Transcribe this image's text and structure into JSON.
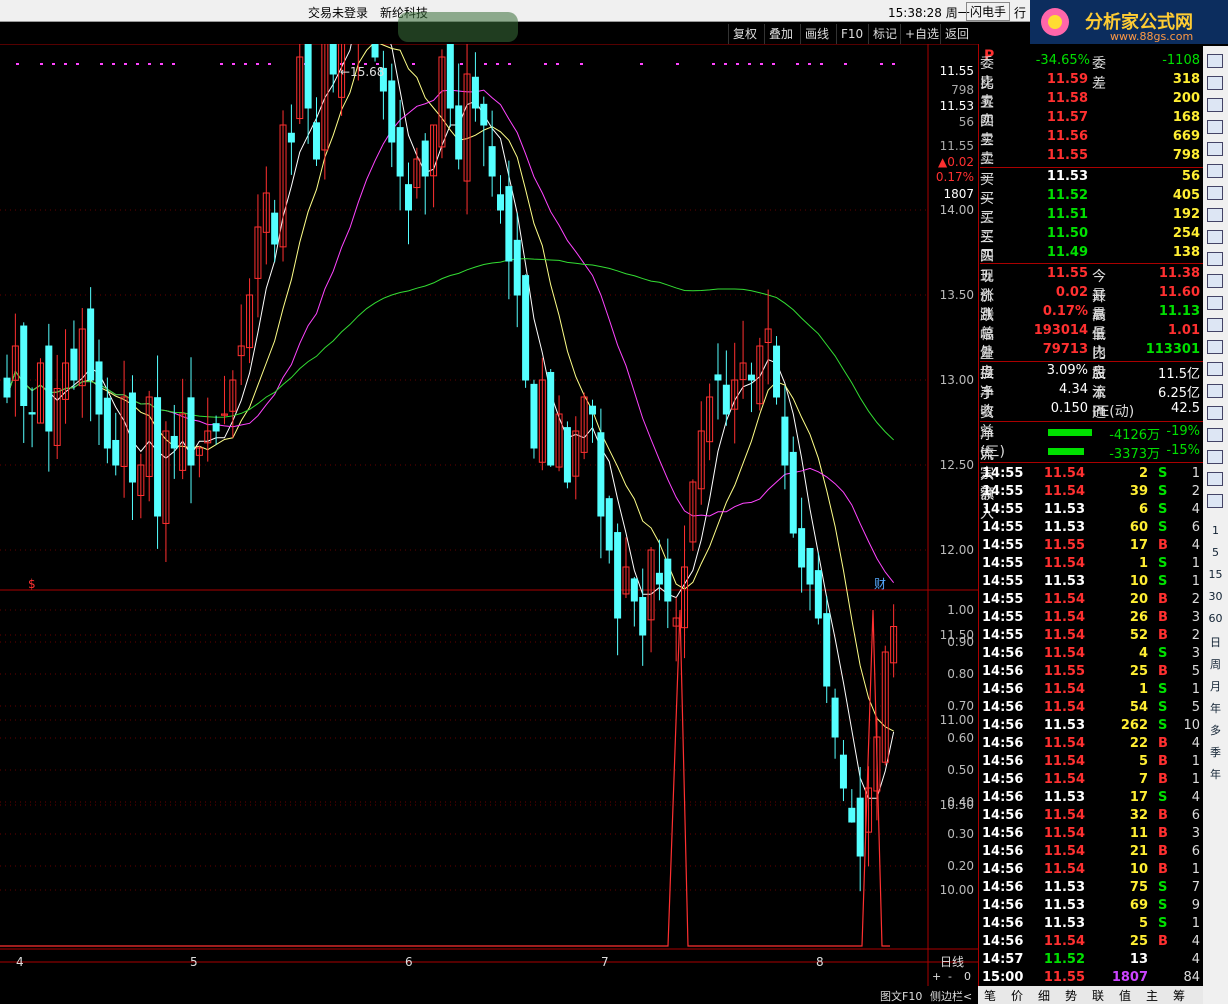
{
  "topbar": {
    "login": "交易未登录",
    "stock": "新纶科技",
    "time": "15:38:28 周一",
    "btn1": "闪电手",
    "btn2": "行"
  },
  "logo": {
    "text": "分析家公式网",
    "url": "www.88gs.com"
  },
  "toolbar": [
    "复权",
    "叠加",
    "画线",
    "F10",
    "标记",
    "+自选",
    "返回"
  ],
  "chart": {
    "peak_label": "15.68",
    "price_axis": [
      "14.00",
      "13.50",
      "13.00",
      "12.50",
      "12.00",
      "11.50",
      "11.00",
      "10.50",
      "10.00"
    ],
    "price_panel": [
      {
        "v": "11.55",
        "c": "white"
      },
      {
        "v": "798",
        "c": "gray"
      },
      {
        "v": "11.53",
        "c": "white"
      },
      {
        "v": "56",
        "c": "gray"
      },
      {
        "v": "11.55",
        "c": "gray"
      },
      {
        "v": "▲0.02",
        "c": "red"
      },
      {
        "v": "0.17%",
        "c": "red"
      },
      {
        "v": "1807",
        "c": "white"
      }
    ],
    "ind_axis": [
      "1.00",
      "0.90",
      "0.80",
      "0.70",
      "0.60",
      "0.50",
      "0.40",
      "0.30",
      "0.20"
    ],
    "x_ticks": [
      "4",
      "5",
      "6",
      "7",
      "8"
    ],
    "period": "日线",
    "marker_s": "$",
    "marker_cai": "财"
  },
  "quote": {
    "p": "P",
    "weibi": {
      "label": "委比",
      "v": "-34.65%",
      "label2": "委差",
      "v2": "-1108"
    },
    "asks": [
      {
        "n": "卖五",
        "p": "11.59",
        "q": "318"
      },
      {
        "n": "卖四",
        "p": "11.58",
        "q": "200"
      },
      {
        "n": "卖三",
        "p": "11.57",
        "q": "168"
      },
      {
        "n": "卖二",
        "p": "11.56",
        "q": "669"
      },
      {
        "n": "卖一",
        "p": "11.55",
        "q": "798"
      }
    ],
    "bids": [
      {
        "n": "买一",
        "p": "11.53",
        "q": "56"
      },
      {
        "n": "买二",
        "p": "11.52",
        "q": "405"
      },
      {
        "n": "买三",
        "p": "11.51",
        "q": "192"
      },
      {
        "n": "买四",
        "p": "11.50",
        "q": "254"
      },
      {
        "n": "买五",
        "p": "11.49",
        "q": "138"
      }
    ],
    "stats": [
      {
        "a": "现价",
        "av": "11.55",
        "b": "今开",
        "bv": "11.38"
      },
      {
        "a": "涨跌",
        "av": "0.02",
        "b": "最高",
        "bv": "11.60"
      },
      {
        "a": "涨幅",
        "av": "0.17%",
        "b": "最低",
        "bv": "11.13"
      },
      {
        "a": "总量",
        "av": "193014",
        "b": "量比",
        "bv": "1.01"
      },
      {
        "a": "外盘",
        "av": "79713",
        "b": "内盘",
        "bv": "113301"
      }
    ],
    "stats2": [
      {
        "a": "换手",
        "av": "3.09%",
        "b": "股本",
        "bv": "11.5亿"
      },
      {
        "a": "净资",
        "av": "4.34",
        "b": "流通",
        "bv": "6.25亿"
      },
      {
        "a": "收益(三)",
        "av": "0.150",
        "b": "PE(动)",
        "bv": "42.5"
      }
    ],
    "flow": [
      {
        "a": "净流入额",
        "v": "-4126万",
        "p": "-19%"
      },
      {
        "a": "大宗流入",
        "v": "-3373万",
        "p": "-15%"
      }
    ]
  },
  "ticks": [
    [
      "14:55",
      "11.54",
      "2",
      "S",
      "1"
    ],
    [
      "14:55",
      "11.54",
      "39",
      "S",
      "2"
    ],
    [
      "14:55",
      "11.53",
      "6",
      "S",
      "4"
    ],
    [
      "14:55",
      "11.53",
      "60",
      "S",
      "6"
    ],
    [
      "14:55",
      "11.55",
      "17",
      "B",
      "4"
    ],
    [
      "14:55",
      "11.54",
      "1",
      "S",
      "1"
    ],
    [
      "14:55",
      "11.53",
      "10",
      "S",
      "1"
    ],
    [
      "14:55",
      "11.54",
      "20",
      "B",
      "2"
    ],
    [
      "14:55",
      "11.54",
      "26",
      "B",
      "3"
    ],
    [
      "14:55",
      "11.54",
      "52",
      "B",
      "2"
    ],
    [
      "14:56",
      "11.54",
      "4",
      "S",
      "3"
    ],
    [
      "14:56",
      "11.55",
      "25",
      "B",
      "5"
    ],
    [
      "14:56",
      "11.54",
      "1",
      "S",
      "1"
    ],
    [
      "14:56",
      "11.54",
      "54",
      "S",
      "5"
    ],
    [
      "14:56",
      "11.53",
      "262",
      "S",
      "10"
    ],
    [
      "14:56",
      "11.54",
      "22",
      "B",
      "4"
    ],
    [
      "14:56",
      "11.54",
      "5",
      "B",
      "1"
    ],
    [
      "14:56",
      "11.54",
      "7",
      "B",
      "1"
    ],
    [
      "14:56",
      "11.53",
      "17",
      "S",
      "4"
    ],
    [
      "14:56",
      "11.54",
      "32",
      "B",
      "6"
    ],
    [
      "14:56",
      "11.54",
      "11",
      "B",
      "3"
    ],
    [
      "14:56",
      "11.54",
      "21",
      "B",
      "6"
    ],
    [
      "14:56",
      "11.54",
      "10",
      "B",
      "1"
    ],
    [
      "14:56",
      "11.53",
      "75",
      "S",
      "7"
    ],
    [
      "14:56",
      "11.53",
      "69",
      "S",
      "9"
    ],
    [
      "14:56",
      "11.53",
      "5",
      "S",
      "1"
    ],
    [
      "14:56",
      "11.54",
      "25",
      "B",
      "4"
    ],
    [
      "14:57",
      "11.52",
      "13",
      "",
      "4"
    ],
    [
      "15:00",
      "11.55",
      "1807",
      "",
      "84"
    ]
  ],
  "right_icons": [
    "1",
    "5",
    "15",
    "30",
    "60",
    "日",
    "周",
    "月",
    "年",
    "多",
    "季",
    "年"
  ],
  "bottom_tabs": [
    "笔",
    "价",
    "细",
    "势",
    "联",
    "值",
    "主",
    "筹"
  ],
  "bottom_left": [
    "图文F10",
    "侧边栏<"
  ],
  "zoom": [
    "+",
    "-",
    "0"
  ]
}
